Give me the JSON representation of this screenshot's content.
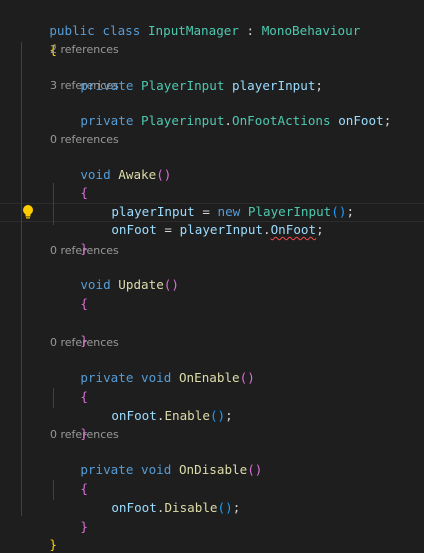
{
  "colors": {
    "background": "#1e1e1e",
    "keyword": "#569cd6",
    "type": "#4ec9b0",
    "variable": "#9cdcfe",
    "function": "#dcdcaa",
    "punctuation": "#d4d4d4",
    "bracket_level1": "#ffd700",
    "bracket_level2": "#da70d6",
    "bracket_level3": "#179fff",
    "codelens": "#999999",
    "error_squiggle": "#f14c4c",
    "lightbulb": "#ffcc00"
  },
  "code": {
    "class_decl": {
      "mod": "public",
      "kw": "class",
      "name": "InputManager",
      "colon": " : ",
      "base": "MonoBehaviour"
    },
    "class_open": "{",
    "field1": {
      "refs": "2 references",
      "mod": "private",
      "type": "PlayerInput",
      "name": "playerInput",
      "semi": ";"
    },
    "field2": {
      "refs": "3 references",
      "mod": "private",
      "type_ns": "Playerinput",
      "dot": ".",
      "type": "OnFootActions",
      "name": "onFoot",
      "semi": ";"
    },
    "awake": {
      "refs": "0 references",
      "ret": "void",
      "name": "Awake",
      "paren_open": "(",
      "paren_close": ")",
      "open": "{",
      "stmt1": {
        "target": "playerInput",
        "assign": " = ",
        "kw": "new",
        "type": "PlayerInput",
        "paren_open": "(",
        "paren_close": ")",
        "semi": ";"
      },
      "stmt2": {
        "target": "onFoot",
        "assign": " = ",
        "source": "playerInput",
        "dot": ".",
        "member": "OnFoot",
        "semi": ";"
      },
      "close": "}"
    },
    "update": {
      "refs": "0 references",
      "ret": "void",
      "name": "Update",
      "paren_open": "(",
      "paren_close": ")",
      "open": "{",
      "close": "}"
    },
    "on_enable": {
      "refs": "0 references",
      "mod": "private",
      "ret": "void",
      "name": "OnEnable",
      "paren_open": "(",
      "paren_close": ")",
      "open": "{",
      "stmt": {
        "target": "onFoot",
        "dot": ".",
        "method": "Enable",
        "paren_open": "(",
        "paren_close": ")",
        "semi": ";"
      },
      "close": "}"
    },
    "on_disable": {
      "refs": "0 references",
      "mod": "private",
      "ret": "void",
      "name": "OnDisable",
      "paren_open": "(",
      "paren_close": ")",
      "open": "{",
      "stmt": {
        "target": "onFoot",
        "dot": ".",
        "method": "Disable",
        "paren_open": "(",
        "paren_close": ")",
        "semi": ";"
      },
      "close": "}"
    },
    "class_close": "}"
  },
  "icons": {
    "lightbulb": "lightbulb-icon"
  }
}
